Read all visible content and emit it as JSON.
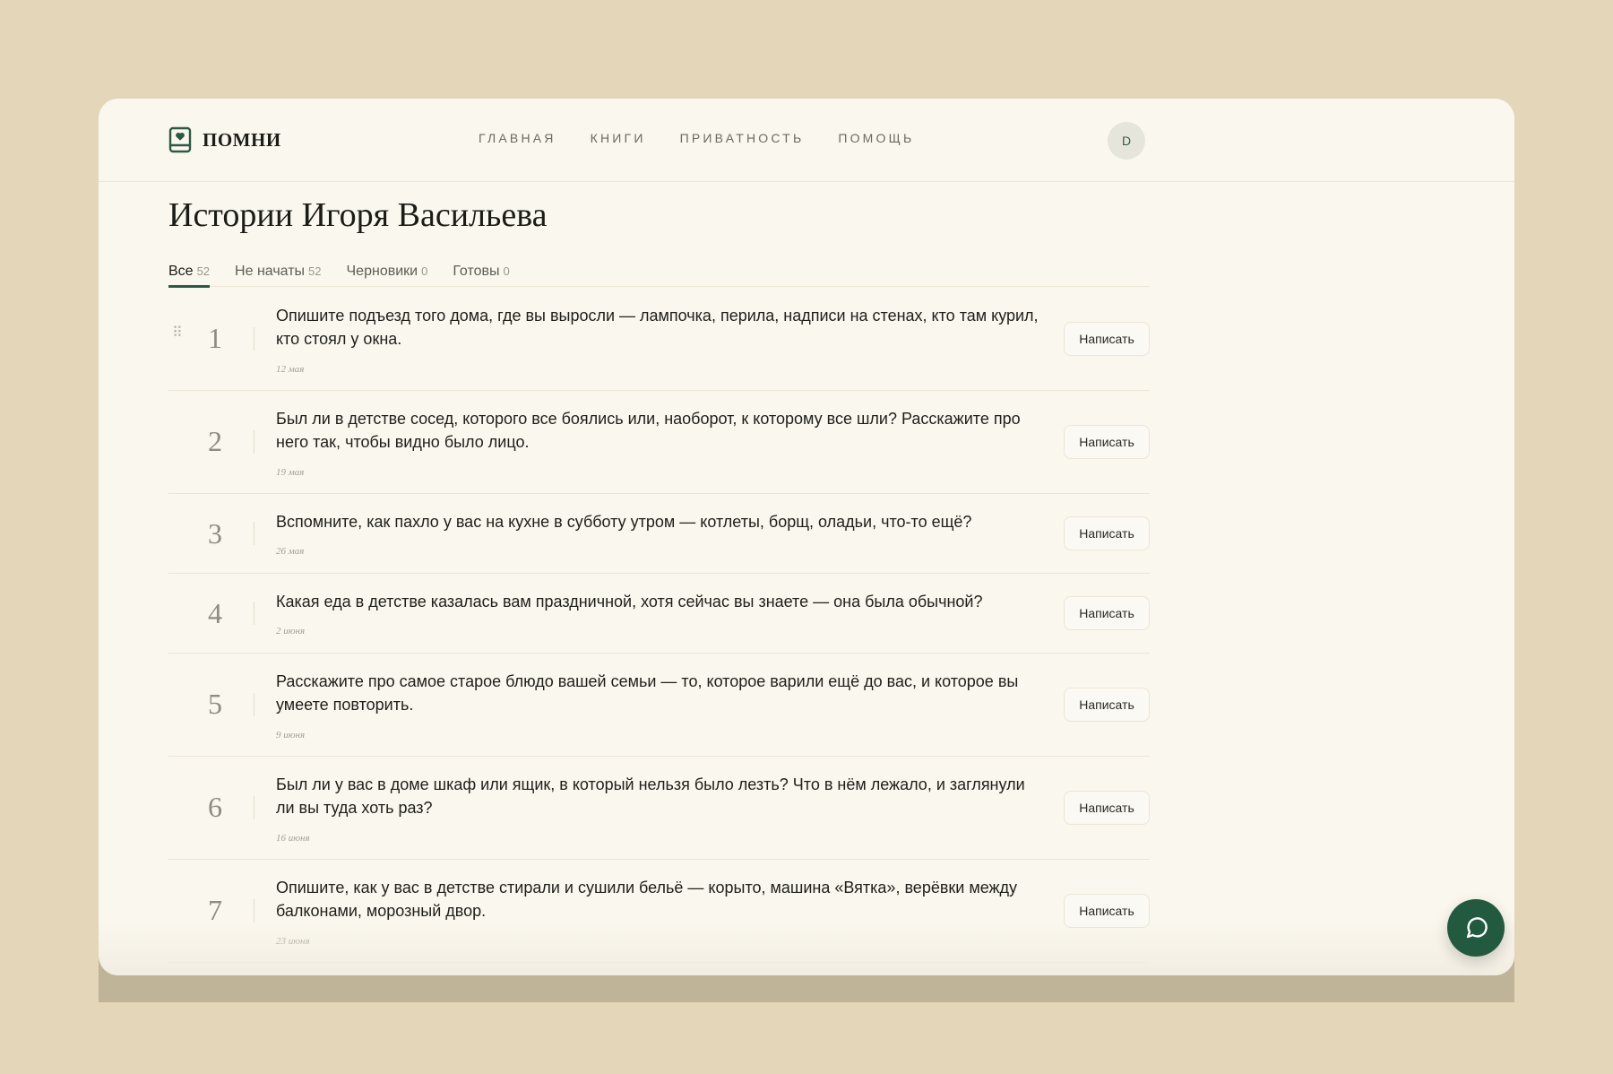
{
  "app": {
    "name": "ПОМНИ"
  },
  "nav": [
    {
      "label": "ГЛАВНАЯ"
    },
    {
      "label": "КНИГИ"
    },
    {
      "label": "ПРИВАТНОСТЬ"
    },
    {
      "label": "ПОМОЩЬ"
    }
  ],
  "user": {
    "initial": "D"
  },
  "page": {
    "title": "Истории Игоря Васильева"
  },
  "tabs": [
    {
      "label": "Все",
      "count": "52"
    },
    {
      "label": "Не начаты",
      "count": "52"
    },
    {
      "label": "Черновики",
      "count": "0"
    },
    {
      "label": "Готовы",
      "count": "0"
    }
  ],
  "stories": [
    {
      "number": "1",
      "question": "Опишите подъезд того дома, где вы выросли — лампочка, перила, надписи на стенах, кто там курил, кто стоял у окна.",
      "date": "12 мая",
      "action": "Написать"
    },
    {
      "number": "2",
      "question": "Был ли в детстве сосед, которого все боялись или, наоборот, к которому все шли? Расскажите про него так, чтобы видно было лицо.",
      "date": "19 мая",
      "action": "Написать"
    },
    {
      "number": "3",
      "question": "Вспомните, как пахло у вас на кухне в субботу утром — котлеты, борщ, оладьи, что-то ещё?",
      "date": "26 мая",
      "action": "Написать"
    },
    {
      "number": "4",
      "question": "Какая еда в детстве казалась вам праздничной, хотя сейчас вы знаете — она была обычной?",
      "date": "2 июня",
      "action": "Написать"
    },
    {
      "number": "5",
      "question": "Расскажите про самое старое блюдо вашей семьи — то, которое варили ещё до вас, и которое вы умеете повторить.",
      "date": "9 июня",
      "action": "Написать"
    },
    {
      "number": "6",
      "question": "Был ли у вас в доме шкаф или ящик, в который нельзя было лезть? Что в нём лежало, и заглянули ли вы туда хоть раз?",
      "date": "16 июня",
      "action": "Написать"
    },
    {
      "number": "7",
      "question": "Опишите, как у вас в детстве стирали и сушили бельё — корыто, машина «Вятка», верёвки между балконами, морозный двор.",
      "date": "23 июня",
      "action": "Написать"
    }
  ],
  "colors": {
    "accent": "#225a40",
    "background": "#e4d6b8",
    "card": "#faf7ee"
  }
}
